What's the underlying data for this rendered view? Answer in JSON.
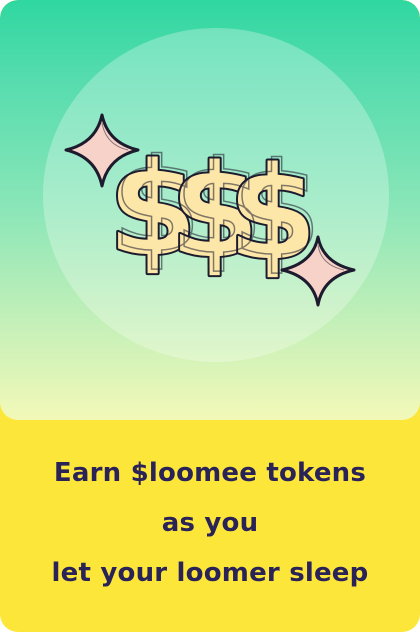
{
  "card": {
    "caption_lines": [
      "Earn $loomee tokens",
      "as you",
      "let your loomer sleep"
    ]
  },
  "icons": {
    "hero": "dollar-signs-icon",
    "sparkles": "sparkle-icon"
  },
  "colors": {
    "card_background": "#fde63a",
    "hero_top": "#2fd7a0",
    "hero_bottom": "#f3f9b8",
    "caption_text": "#2a2357",
    "dollar_fill": "#fde7a8",
    "sparkle_fill": "#f7d2c8",
    "outline": "#1d1b2e"
  }
}
